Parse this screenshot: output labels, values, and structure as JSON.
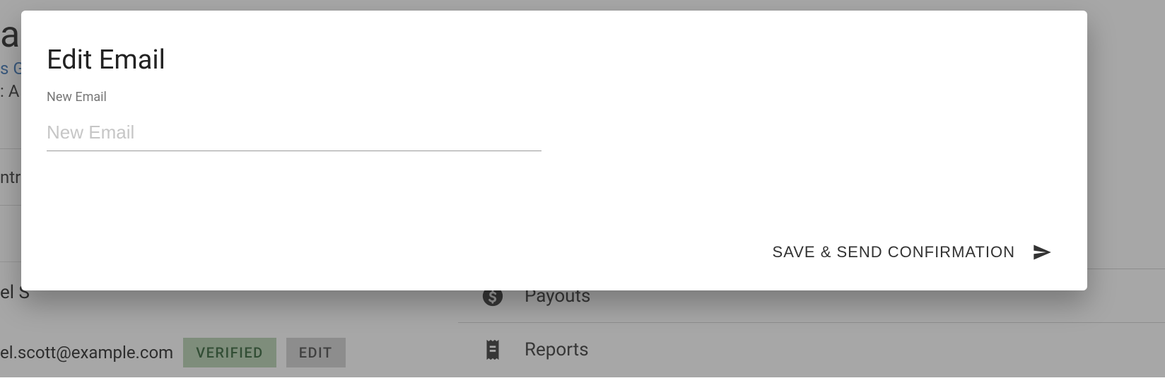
{
  "background": {
    "title_fragment": "al",
    "link_fragment": "s G",
    "sub_fragment": ": A",
    "row1_fragment": "ntr",
    "name_fragment": "el S",
    "email_fragment": "el.scott@example.com",
    "verified_badge": "VERIFIED",
    "edit_badge": "EDIT",
    "nav": {
      "payouts": "Payouts",
      "reports": "Reports"
    }
  },
  "modal": {
    "title": "Edit Email",
    "field_label": "New Email",
    "placeholder": "New Email",
    "action_label": "SAVE & SEND CONFIRMATION"
  },
  "icons": {
    "payouts": "dollar-circle-icon",
    "reports": "receipt-icon",
    "send": "send-icon"
  },
  "colors": {
    "verified_bg": "#b4cfb0",
    "verified_fg": "#2b5d31",
    "edit_bg": "#cfcfcf",
    "link": "#3a73b4"
  }
}
